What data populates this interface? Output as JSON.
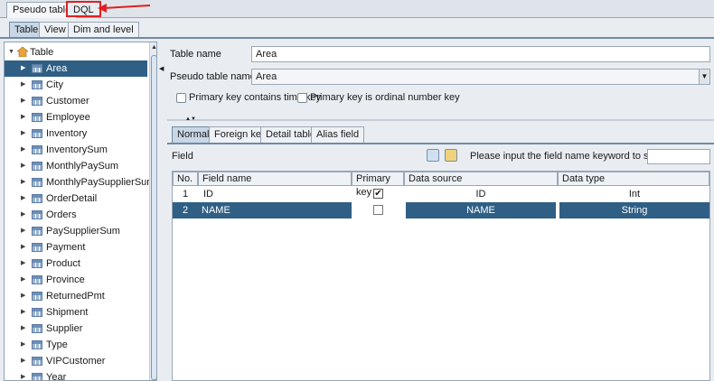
{
  "top_tabs": [
    "Pseudo table",
    "DQL"
  ],
  "sub_tabs": [
    "Table",
    "View",
    "Dim and level"
  ],
  "tree": {
    "root": "Table",
    "items": [
      "Area",
      "City",
      "Customer",
      "Employee",
      "Inventory",
      "InventorySum",
      "MonthlyPaySum",
      "MonthlyPaySupplierSum",
      "OrderDetail",
      "Orders",
      "PaySupplierSum",
      "Payment",
      "Product",
      "Province",
      "ReturnedPmt",
      "Shipment",
      "Supplier",
      "Type",
      "VIPCustomer",
      "Year"
    ]
  },
  "form": {
    "table_name_label": "Table name",
    "table_name_value": "Area",
    "pseudo_label": "Pseudo table name",
    "pseudo_value": "Area",
    "chk_time": "Primary key contains time key",
    "chk_ordinal": "Primary key is ordinal number key"
  },
  "bottom_tabs": [
    "Normal",
    "Foreign key",
    "Detail table",
    "Alias field"
  ],
  "field": {
    "label": "Field",
    "search_label": "Please input the field name keyword to search:",
    "columns": [
      "No.",
      "Field name",
      "Primary key",
      "Data source",
      "Data type"
    ],
    "rows": [
      {
        "no": "1",
        "name": "ID",
        "pk": true,
        "source": "ID",
        "type": "Int"
      },
      {
        "no": "2",
        "name": "NAME",
        "pk": false,
        "source": "NAME",
        "type": "String"
      }
    ]
  },
  "colors": {
    "selection": "#2f5f85",
    "highlight": "#e02020"
  }
}
